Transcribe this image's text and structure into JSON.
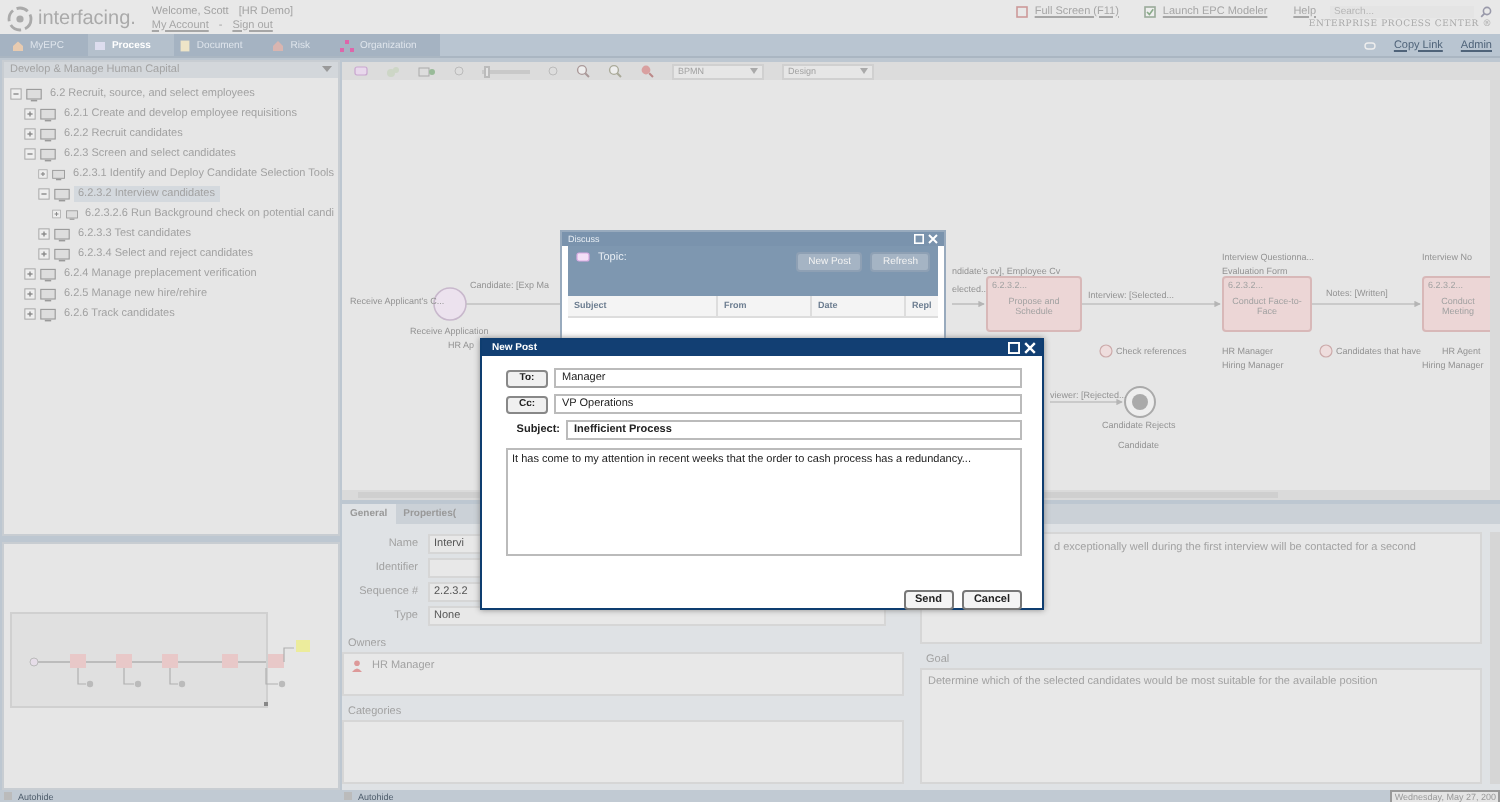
{
  "header": {
    "brand": "interfacing.",
    "welcome": "Welcome, Scott",
    "account": "[HR Demo]",
    "links": [
      "My Account",
      "Sign out"
    ],
    "separator": "-",
    "top_links": [
      {
        "kind": "fullscreen",
        "label": "Full Screen (F11)"
      },
      {
        "kind": "modeler",
        "label": "Launch EPC Modeler"
      },
      {
        "kind": "plain",
        "label": "Help"
      }
    ],
    "search": {
      "placeholder": "Search..."
    },
    "product": "ENTERPRISE PROCESS CENTER ®"
  },
  "tabs": [
    {
      "kind": "home",
      "label": "MyEPC",
      "selected": false
    },
    {
      "kind": "process",
      "label": "Process",
      "selected": true
    },
    {
      "kind": "document",
      "label": "Document",
      "selected": false
    },
    {
      "kind": "risk",
      "label": "Risk",
      "selected": false
    },
    {
      "kind": "organization",
      "label": "Organization",
      "selected": false
    }
  ],
  "tab_bar_links": [
    {
      "kind": "copy",
      "label": "Copy Link"
    },
    {
      "kind": "plain",
      "label": "Admin"
    }
  ],
  "left_panel": {
    "title": "Develop & Manage Human Capital",
    "tree": [
      {
        "label": "6.2 Recruit, source, and select employees",
        "expanded": true,
        "selected": false,
        "children": [
          {
            "label": "6.2.1 Create and develop employee requisitions",
            "expanded": false,
            "selected": false
          },
          {
            "label": "6.2.2 Recruit candidates",
            "expanded": false,
            "selected": false
          },
          {
            "label": "6.2.3 Screen and select candidates",
            "expanded": true,
            "selected": false,
            "children": [
              {
                "label": "6.2.3.1 Identify and Deploy Candidate Selection Tools",
                "expanded": false,
                "selected": false
              },
              {
                "label": "6.2.3.2 Interview candidates",
                "expanded": true,
                "selected": true,
                "children": [
                  {
                    "label": "6.2.3.2.6 Run Background check on potential candi",
                    "expanded": false,
                    "selected": false
                  }
                ]
              },
              {
                "label": "6.2.3.3 Test candidates",
                "expanded": false,
                "selected": false
              },
              {
                "label": "6.2.3.4 Select and reject candidates",
                "expanded": false,
                "selected": false
              }
            ]
          },
          {
            "label": "6.2.4 Manage preplacement verification",
            "expanded": false,
            "selected": false
          },
          {
            "label": "6.2.5 Manage new hire/rehire",
            "expanded": false,
            "selected": false
          },
          {
            "label": "6.2.6 Track candidates",
            "expanded": false,
            "selected": false
          }
        ]
      }
    ]
  },
  "toolbar": {
    "zoom_slider": {
      "level": 0.05
    },
    "dropdowns": [
      "BPMN",
      "Design"
    ]
  },
  "diagram": {
    "labels": [
      "Receive Applicant's C...",
      "Candidate: [Exp Ma",
      "Receive Application",
      "HR Ap",
      "ndidate's cv], Employee Cv",
      "elected...",
      "Interview: [Selected...",
      "Check references",
      "Interview Questionna...",
      "Evaluation Form",
      "Notes: [Written]",
      "HR Manager",
      "Hiring Manager",
      "Candidates that have",
      "Interview No",
      "HR Agent",
      "Hiring Manager",
      "viewer: [Rejected...",
      "Candidate Rejects",
      "Candidate"
    ],
    "tasks": [
      {
        "number": "6.2.3.2...",
        "name": "Propose and Schedule"
      },
      {
        "number": "6.2.3.2...",
        "name": "Conduct Face-to-Face"
      },
      {
        "number": "6.2.3.2...",
        "name": "Conduct Meeting"
      }
    ]
  },
  "discuss_window": {
    "title": "Discuss",
    "topic_label": "Topic:",
    "buttons": [
      "New Post",
      "Refresh"
    ],
    "columns": [
      "Subject",
      "From",
      "Date",
      "Repl"
    ]
  },
  "new_post": {
    "title": "New Post",
    "to": {
      "button": "To:",
      "value": "Manager"
    },
    "cc": {
      "button": "Cc:",
      "value": "VP Operations"
    },
    "subject": {
      "label": "Subject:",
      "value": "Inefficient Process"
    },
    "message": "It has come to my attention in recent weeks that the order to cash process has a redundancy...",
    "buttons": [
      "Send",
      "Cancel"
    ]
  },
  "properties": {
    "tabs": [
      {
        "label": "General",
        "selected": true
      },
      {
        "label": "Properties(",
        "selected": false
      }
    ],
    "fields": [
      {
        "label": "Name",
        "value": "Intervi"
      },
      {
        "label": "Identifier"
      },
      {
        "label": "Sequence #",
        "value": "2.2.3.2"
      },
      {
        "label": "Type",
        "value": "None"
      }
    ],
    "owners": {
      "title": "Owners",
      "items": [
        "HR Manager"
      ]
    },
    "categories": {
      "title": "Categories"
    },
    "description": "d exceptionally well during the first interview will be contacted for a second",
    "goal": {
      "title": "Goal",
      "text": "Determine which of the selected candidates would be most suitable for the available position"
    }
  },
  "status_bar": {
    "autohide": [
      "Autohide",
      "Autohide"
    ],
    "date": "Wednesday, May 27, 200"
  }
}
